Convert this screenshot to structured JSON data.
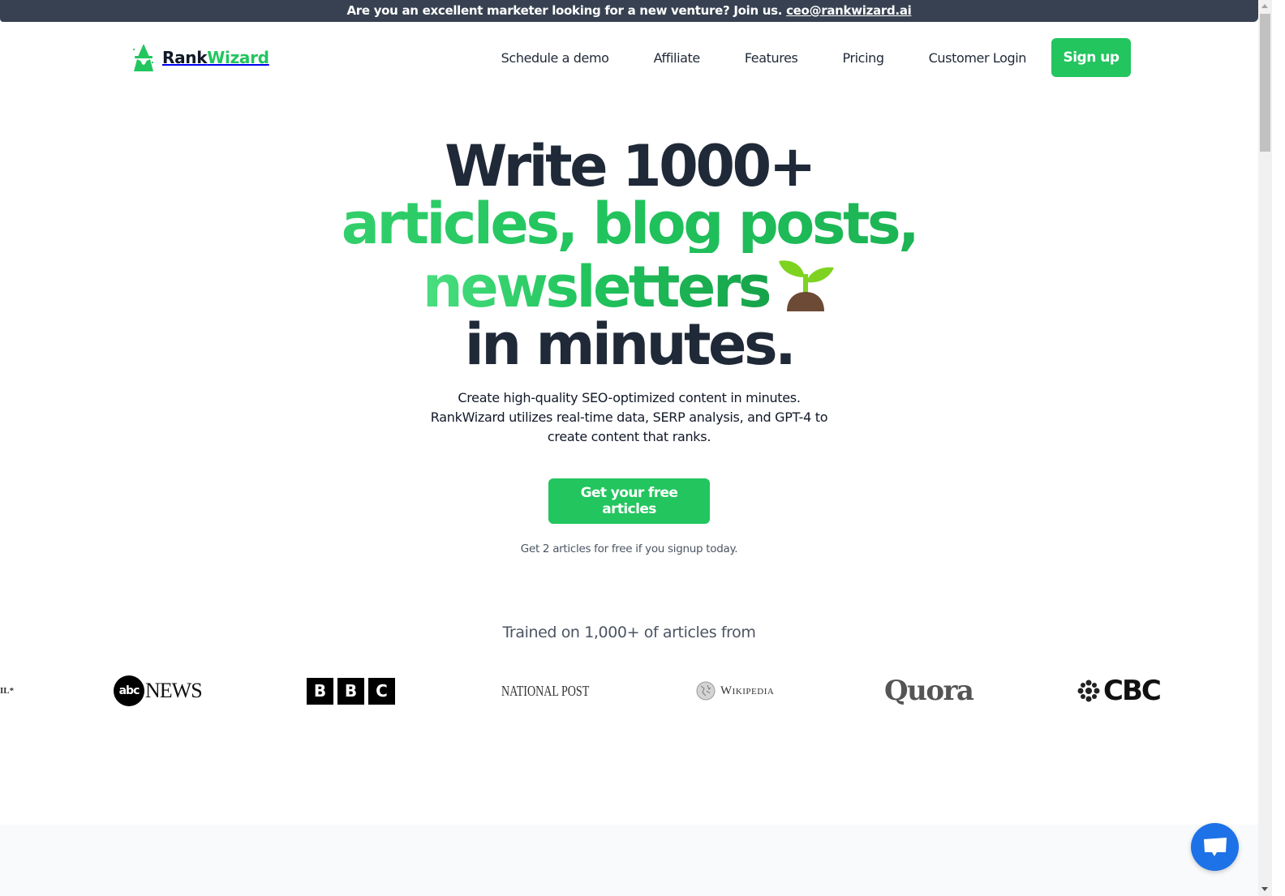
{
  "banner": {
    "text": "Are you an excellent marketer looking for a new venture? Join us.",
    "email": "ceo@rankwizard.ai"
  },
  "brand": {
    "name_part1": "Rank",
    "name_part2": "Wizard",
    "primary_color": "#22c55e",
    "dark_color": "#1f2937"
  },
  "nav": {
    "links": [
      {
        "label": "Schedule a demo"
      },
      {
        "label": "Affiliate"
      },
      {
        "label": "Features"
      },
      {
        "label": "Pricing"
      },
      {
        "label": "Customer Login"
      }
    ],
    "signup_label": "Sign up"
  },
  "hero": {
    "line1": "Write 1000+",
    "line2": "articles, blog posts,",
    "line3": "newsletters",
    "line4": "in minutes.",
    "emoji_icon": "seedling-icon",
    "subtitle_line1": "Create high-quality SEO-optimized content in minutes.",
    "subtitle_line2": "RankWizard utilizes real-time data, SERP analysis, and GPT-4 to",
    "subtitle_line3": "create content that ranks.",
    "cta_label": "Get your free articles",
    "note": "Get 2 articles for free if you signup today."
  },
  "trained": {
    "heading": "Trained on 1,000+ of articles from",
    "logos": [
      {
        "name": "partial-logo",
        "text": "IL*"
      },
      {
        "name": "abc-news",
        "text_abc": "abc",
        "text_news": "NEWS"
      },
      {
        "name": "bbc",
        "letters": [
          "B",
          "B",
          "C"
        ]
      },
      {
        "name": "national-post",
        "text": "NATIONAL POST"
      },
      {
        "name": "wikipedia",
        "text": "Wikipedia"
      },
      {
        "name": "quora",
        "text": "Quora"
      },
      {
        "name": "cbc",
        "text": "CBC"
      }
    ]
  },
  "chat": {
    "icon": "chat-bubble-icon",
    "color": "#1d72e8"
  }
}
